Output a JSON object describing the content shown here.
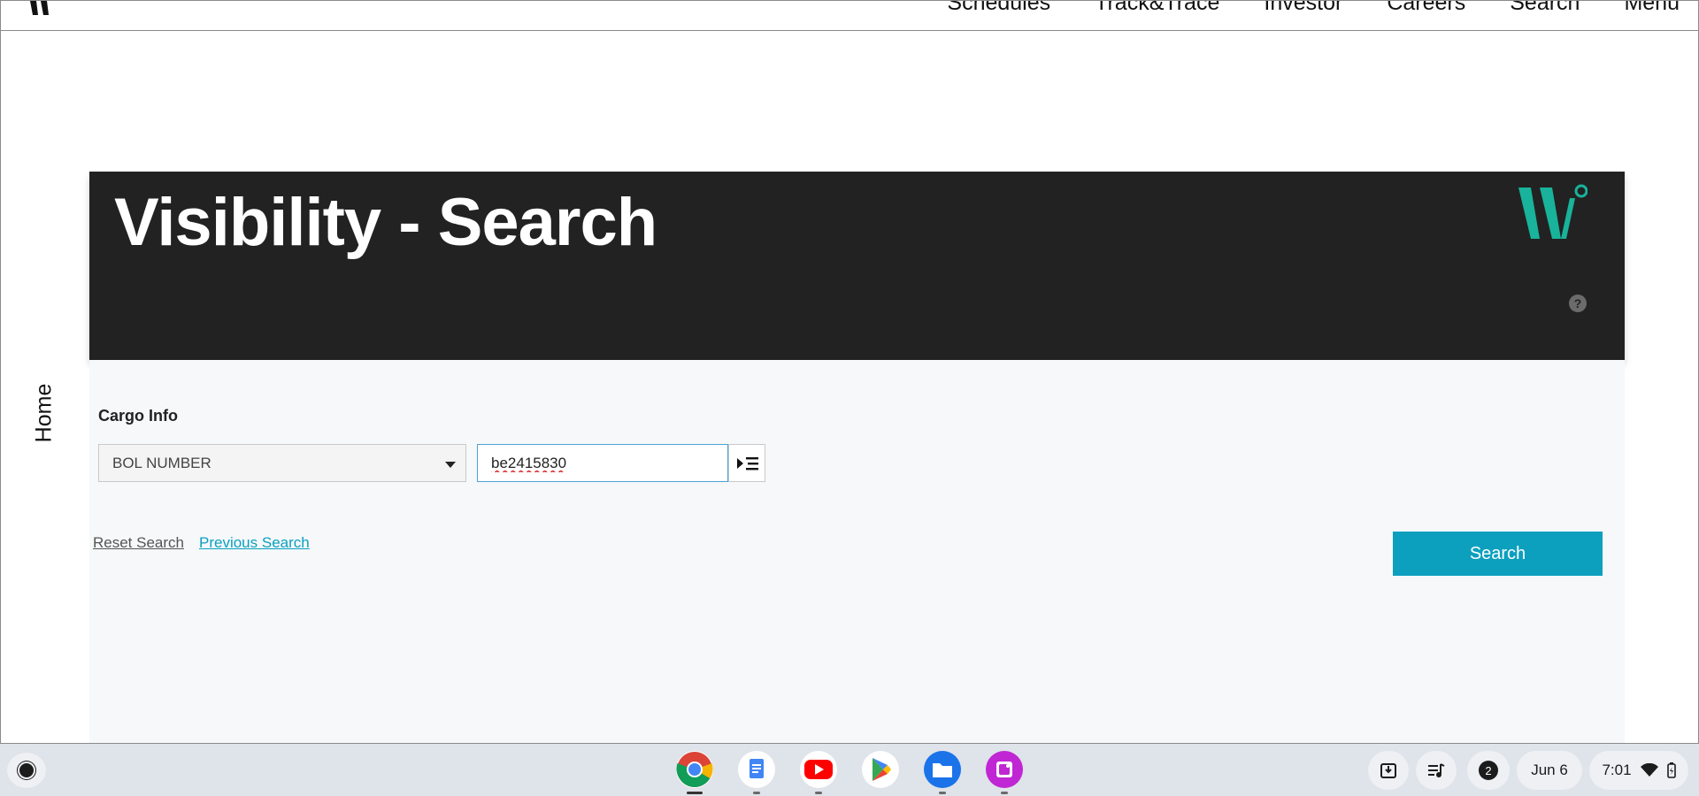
{
  "nav": {
    "items": [
      "Schedules",
      "Track&Trace",
      "Investor",
      "Careers",
      "Search",
      "Menu"
    ]
  },
  "side": {
    "home_label": "Home"
  },
  "hero": {
    "title": "Visibility - Search",
    "help_icon": "?"
  },
  "form": {
    "section_label": "Cargo Info",
    "search_type": "BOL NUMBER",
    "search_value": "be2415830",
    "reset_link": "Reset Search",
    "previous_link": "Previous Search",
    "search_button": "Search"
  },
  "shelf": {
    "apps": [
      "chrome",
      "docs",
      "youtube",
      "play-store",
      "files",
      "canvas"
    ],
    "notification_count": "2",
    "date": "Jun 6",
    "time": "7:01"
  },
  "colors": {
    "hero_bg": "#222222",
    "accent": "#0ca0be",
    "logo": "#18b39a",
    "panel_bg": "#f6f8fa"
  }
}
